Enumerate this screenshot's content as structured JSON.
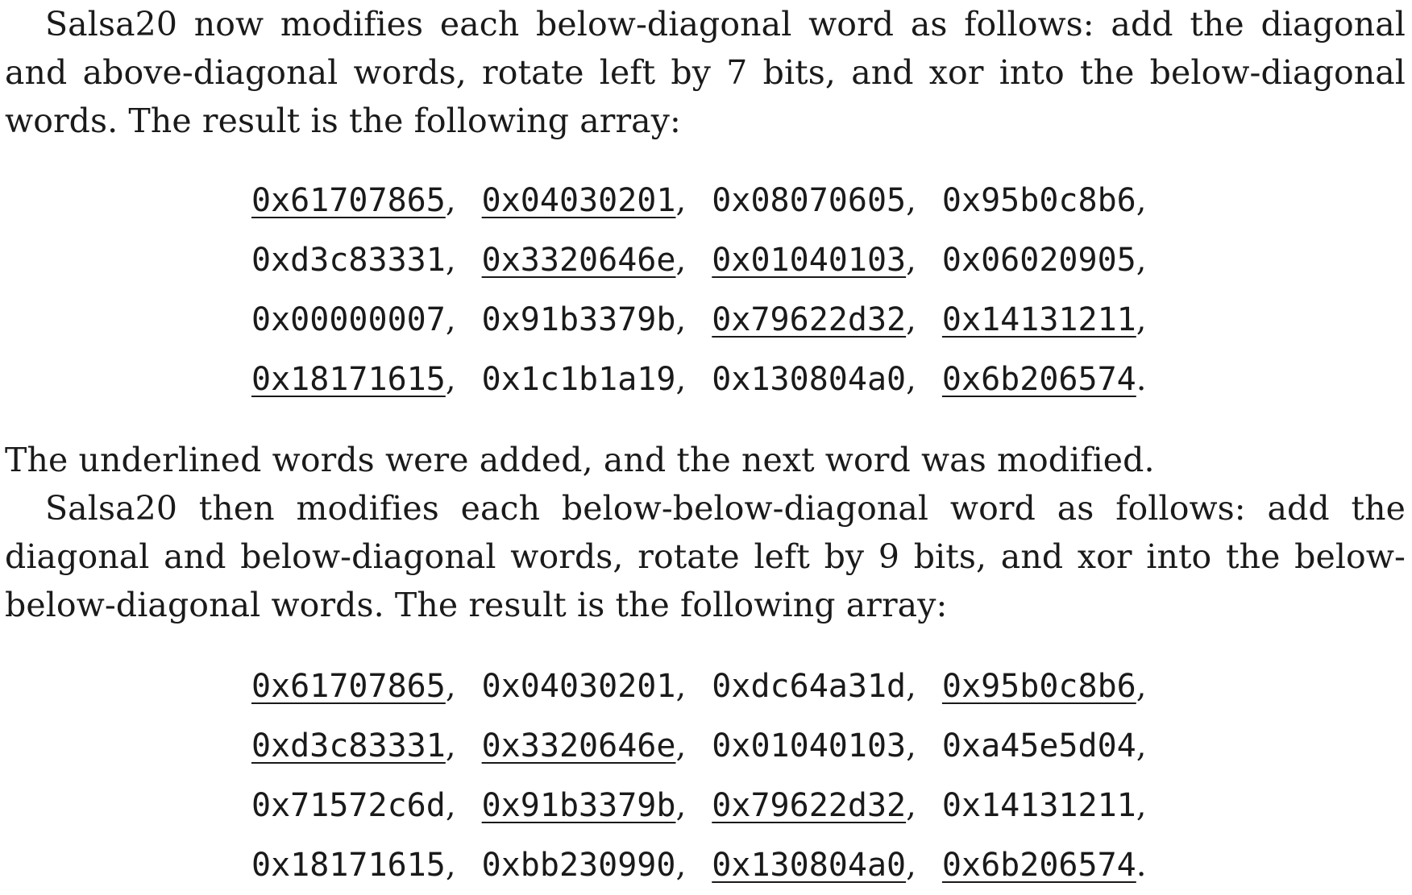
{
  "paragraphs": {
    "p1": "Salsa20 now modifies each below-diagonal word as follows: add the diagonal and above-diagonal words, rotate left by 7 bits, and xor into the below-diagonal words. The result is the following array:",
    "p2": "The underlined words were added, and the next word was modified.",
    "p3": "Salsa20 then modifies each below-below-diagonal word as follows: add the diagonal and below-diagonal words, rotate left by 9 bits, and xor into the below-below-diagonal words. The result is the following array:"
  },
  "arrays": [
    {
      "rows": [
        [
          {
            "w": "0x61707865",
            "u": true
          },
          {
            "w": "0x04030201",
            "u": true
          },
          {
            "w": "0x08070605",
            "u": false
          },
          {
            "w": "0x95b0c8b6",
            "u": false
          }
        ],
        [
          {
            "w": "0xd3c83331",
            "u": false
          },
          {
            "w": "0x3320646e",
            "u": true
          },
          {
            "w": "0x01040103",
            "u": true
          },
          {
            "w": "0x06020905",
            "u": false
          }
        ],
        [
          {
            "w": "0x00000007",
            "u": false
          },
          {
            "w": "0x91b3379b",
            "u": false
          },
          {
            "w": "0x79622d32",
            "u": true
          },
          {
            "w": "0x14131211",
            "u": true
          }
        ],
        [
          {
            "w": "0x18171615",
            "u": true
          },
          {
            "w": "0x1c1b1a19",
            "u": false
          },
          {
            "w": "0x130804a0",
            "u": false
          },
          {
            "w": "0x6b206574",
            "u": true
          }
        ]
      ]
    },
    {
      "rows": [
        [
          {
            "w": "0x61707865",
            "u": true
          },
          {
            "w": "0x04030201",
            "u": false
          },
          {
            "w": "0xdc64a31d",
            "u": false
          },
          {
            "w": "0x95b0c8b6",
            "u": true
          }
        ],
        [
          {
            "w": "0xd3c83331",
            "u": true
          },
          {
            "w": "0x3320646e",
            "u": true
          },
          {
            "w": "0x01040103",
            "u": false
          },
          {
            "w": "0xa45e5d04",
            "u": false
          }
        ],
        [
          {
            "w": "0x71572c6d",
            "u": false
          },
          {
            "w": "0x91b3379b",
            "u": true
          },
          {
            "w": "0x79622d32",
            "u": true
          },
          {
            "w": "0x14131211",
            "u": false
          }
        ],
        [
          {
            "w": "0x18171615",
            "u": false
          },
          {
            "w": "0xbb230990",
            "u": false
          },
          {
            "w": "0x130804a0",
            "u": true
          },
          {
            "w": "0x6b206574",
            "u": true
          }
        ]
      ]
    }
  ]
}
